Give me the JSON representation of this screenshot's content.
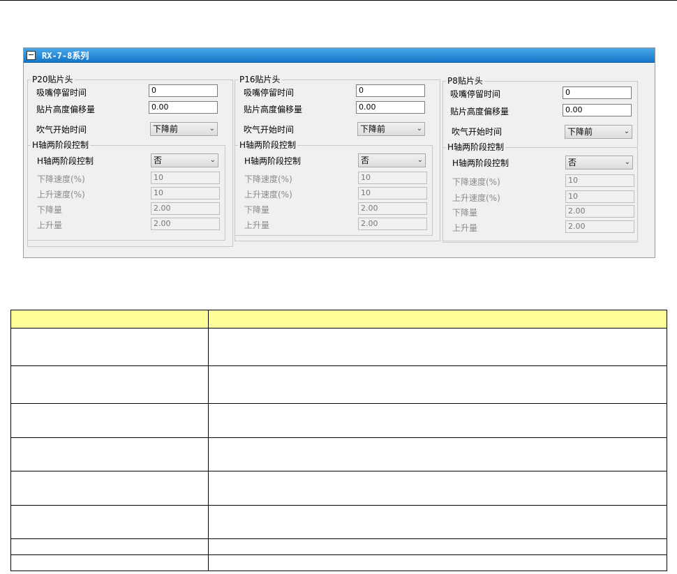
{
  "panel": {
    "collapse_icon": "−",
    "title": "RX-7-8系列"
  },
  "heads": [
    {
      "name": "P20贴片头",
      "dwell_label": "吸嘴停留时间",
      "dwell_value": "0",
      "offset_label": "贴片高度偏移量",
      "offset_value": "0.00",
      "blow_label": "吹气开始时间",
      "blow_value": "下降前",
      "h_group": "H轴两阶段控制",
      "h_label": "H轴两阶段控制",
      "h_value": "否",
      "down_speed_label": "下降速度(%)",
      "down_speed_value": "10",
      "up_speed_label": "上升速度(%)",
      "up_speed_value": "10",
      "down_amount_label": "下降量",
      "down_amount_value": "2.00",
      "up_amount_label": "上升量",
      "up_amount_value": "2.00"
    },
    {
      "name": "P16贴片头",
      "dwell_label": "吸嘴停留时间",
      "dwell_value": "0",
      "offset_label": "贴片高度偏移量",
      "offset_value": "0.00",
      "blow_label": "吹气开始时间",
      "blow_value": "下降前",
      "h_group": "H轴两阶段控制",
      "h_label": "H轴两阶段控制",
      "h_value": "否",
      "down_speed_label": "下降速度(%)",
      "down_speed_value": "10",
      "up_speed_label": "上升速度(%)",
      "up_speed_value": "10",
      "down_amount_label": "下降量",
      "down_amount_value": "2.00",
      "up_amount_label": "上升量",
      "up_amount_value": "2.00"
    },
    {
      "name": "P8贴片头",
      "dwell_label": "吸嘴停留时间",
      "dwell_value": "0",
      "offset_label": "贴片高度偏移量",
      "offset_value": "0.00",
      "blow_label": "吹气开始时间",
      "blow_value": "下降前",
      "h_group": "H轴两阶段控制",
      "h_label": "H轴两阶段控制",
      "h_value": "否",
      "down_speed_label": "下降速度(%)",
      "down_speed_value": "10",
      "up_speed_label": "上升速度(%)",
      "up_speed_value": "10",
      "down_amount_label": "下降量",
      "down_amount_value": "2.00",
      "up_amount_label": "上升量",
      "up_amount_value": "2.00"
    }
  ],
  "icons": {
    "dropdown": "chevron-down-icon",
    "collapse": "collapse-minus-icon"
  },
  "colors": {
    "titlebar": "#1f86d6",
    "table_header": "#ffff99"
  }
}
